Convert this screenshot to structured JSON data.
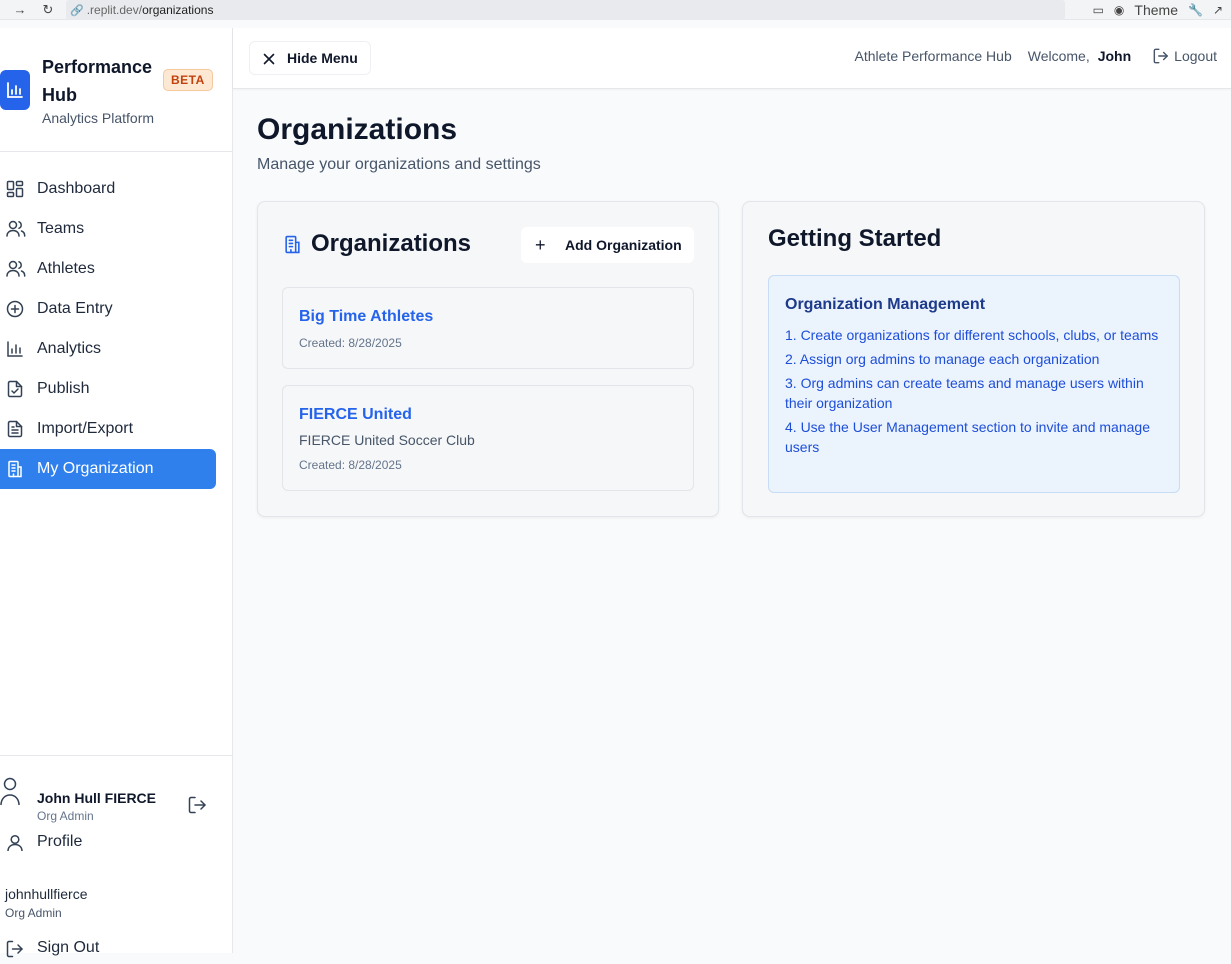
{
  "browser": {
    "url_prefix": ".replit.dev/",
    "url_path": "organizations",
    "theme_label": "Theme"
  },
  "sidebar": {
    "brand_title": "Performance Hub",
    "beta_badge": "BETA",
    "brand_subtitle": "Analytics Platform",
    "items": [
      {
        "label": "Dashboard",
        "icon": "dashboard-icon"
      },
      {
        "label": "Teams",
        "icon": "users-icon"
      },
      {
        "label": "Athletes",
        "icon": "users-icon"
      },
      {
        "label": "Data Entry",
        "icon": "plus-circle-icon"
      },
      {
        "label": "Analytics",
        "icon": "bar-chart-icon"
      },
      {
        "label": "Publish",
        "icon": "file-check-icon"
      },
      {
        "label": "Import/Export",
        "icon": "file-text-icon"
      },
      {
        "label": "My Organization",
        "icon": "building-icon",
        "active": true
      }
    ],
    "user": {
      "name": "John Hull FIERCE",
      "role": "Org Admin"
    },
    "profile_label": "Profile",
    "account_username": "johnhullfierce",
    "account_role": "Org Admin",
    "signout_label": "Sign Out"
  },
  "topbar": {
    "hide_menu_label": "Hide Menu",
    "app_name": "Athlete Performance Hub",
    "welcome_label": "Welcome,",
    "user_first_name": "John",
    "logout_label": "Logout"
  },
  "page": {
    "title": "Organizations",
    "subtitle": "Manage your organizations and settings"
  },
  "organizations": {
    "heading": "Organizations",
    "add_button_label": "Add Organization",
    "items": [
      {
        "name": "Big Time Athletes",
        "description": "",
        "created": "Created: 8/28/2025"
      },
      {
        "name": "FIERCE United",
        "description": "FIERCE United Soccer Club",
        "created": "Created: 8/28/2025"
      }
    ]
  },
  "getting_started": {
    "heading": "Getting Started",
    "box_title": "Organization Management",
    "steps": [
      "1. Create organizations for different schools, clubs, or teams",
      "2. Assign org admins to manage each organization",
      "3. Org admins can create teams and manage users within their organization",
      "4. Use the User Management section to invite and manage users"
    ]
  },
  "colors": {
    "accent": "#2f80ed",
    "link": "#2563eb",
    "info_bg": "#ebf3fd",
    "beta_text": "#c2410c"
  }
}
